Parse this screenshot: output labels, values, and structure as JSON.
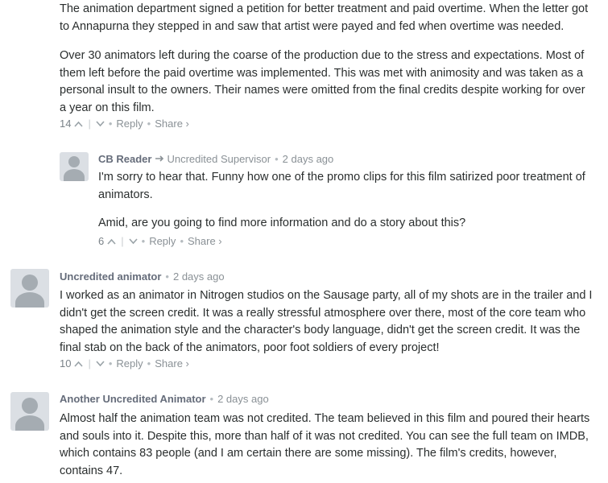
{
  "comments": [
    {
      "paragraphs": [
        "The animation department signed a petition for better treatment and paid overtime. When the letter got to Annapurna they stepped in and saw that artist were payed and fed when overtime was needed.",
        "Over 30 animators left during the coarse of the production due to the stress and expectations. Most of them left before the paid overtime was implemented. This was met with animosity and was taken as a personal insult to the owners. Their names were omitted from the final credits despite working for over a year on this film."
      ],
      "votes": "14",
      "reply_label": "Reply",
      "share_label": "Share ›"
    },
    {
      "author": "CB Reader",
      "reply_to": "Uncredited Supervisor",
      "time": "2 days ago",
      "paragraphs": [
        "I'm sorry to hear that. Funny how one of the promo clips for this film satirized poor treatment of animators.",
        "Amid, are you going to find more information and do a story about this?"
      ],
      "votes": "6",
      "reply_label": "Reply",
      "share_label": "Share ›"
    },
    {
      "author": "Uncredited animator",
      "time": "2 days ago",
      "paragraphs": [
        "I worked as an animator in Nitrogen studios on the Sausage party, all of my shots are in the trailer and I didn't get the screen credit. It was a really stressful atmosphere over there, most of the core team who shaped the animation style and the character's body language, didn't get the screen credit. It was the final stab on the back of the animators, poor foot soldiers of every project!"
      ],
      "votes": "10",
      "reply_label": "Reply",
      "share_label": "Share ›"
    },
    {
      "author": "Another Uncredited Animator",
      "time": "2 days ago",
      "paragraphs": [
        "Almost half the animation team was not credited. The team believed in this film and poured their hearts and souls into it. Despite this, more than half of it was not credited. You can see the full team on IMDB, which contains 83 people (and I am certain there are some missing). The film's credits, however, contains 47."
      ]
    }
  ],
  "icons": {
    "upvote": "chevron-up-icon",
    "downvote": "chevron-down-icon",
    "reply_arrow": "reply-arrow-icon",
    "avatar": "default-avatar-icon"
  }
}
